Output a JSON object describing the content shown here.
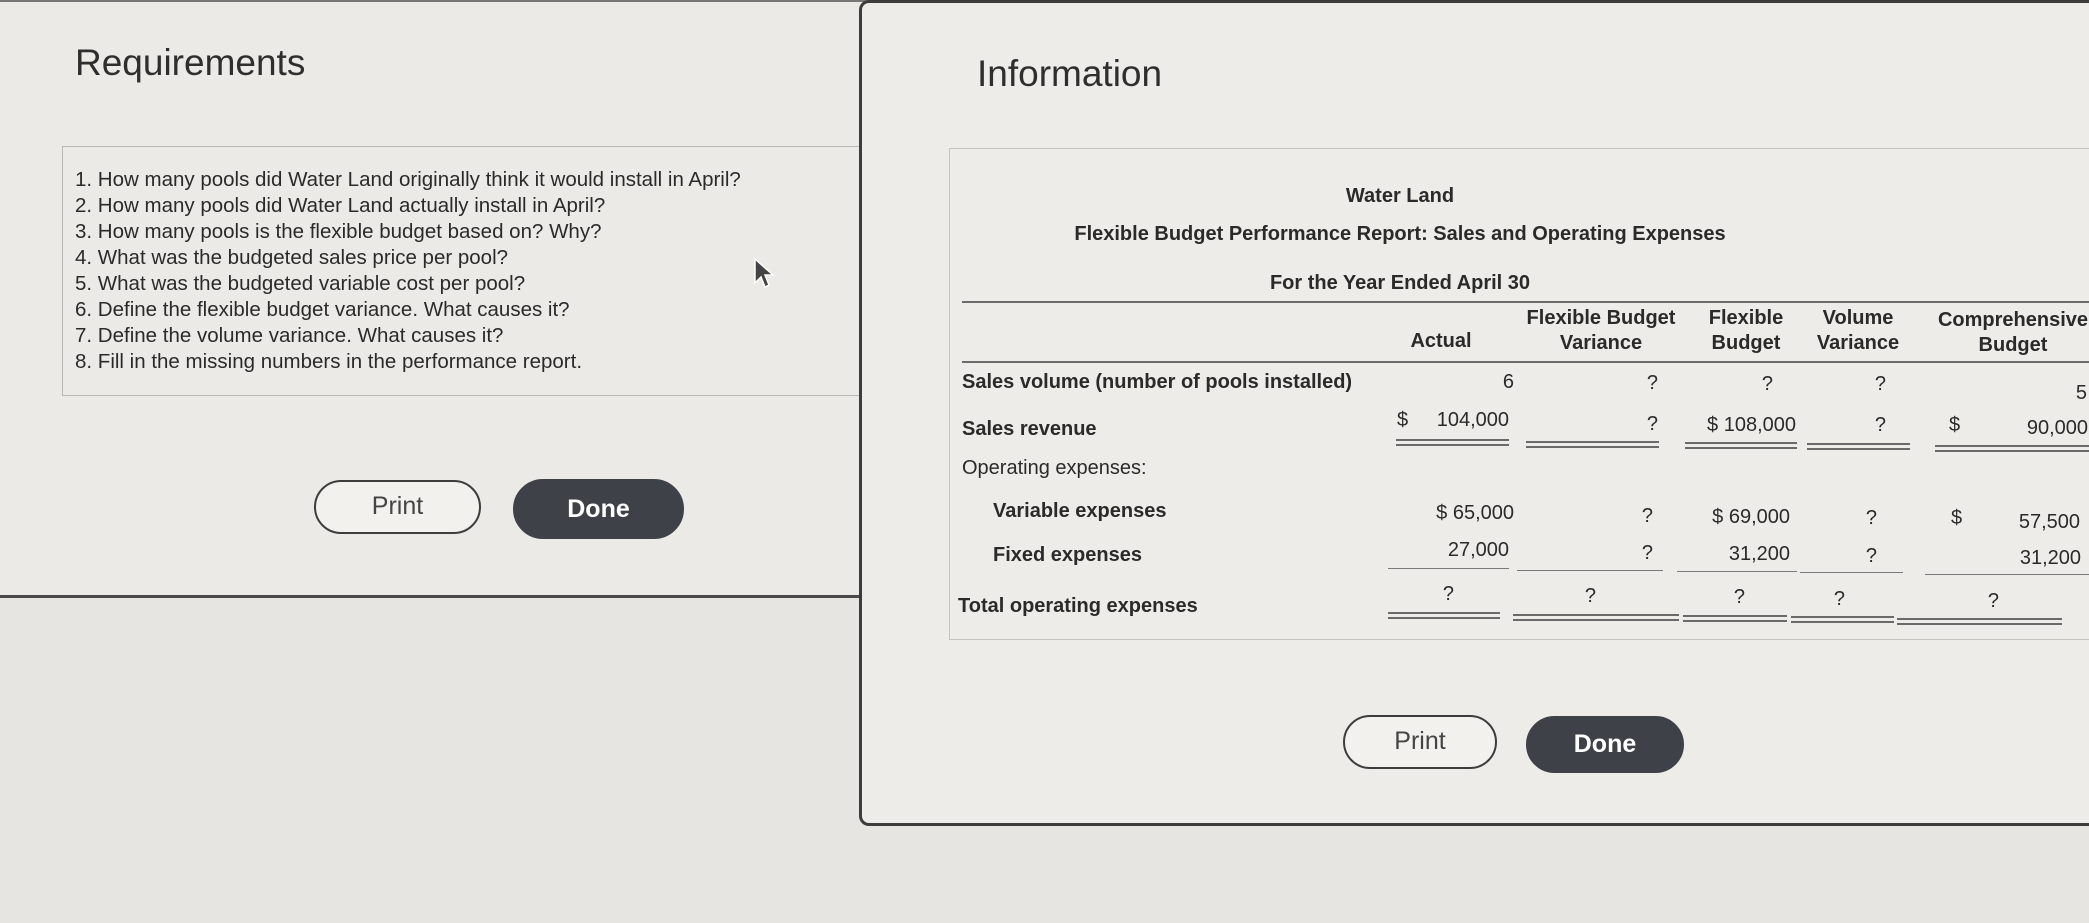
{
  "requirements": {
    "title": "Requirements",
    "items": [
      "1. How many pools did Water Land originally think it would install in April?",
      "2. How many pools did Water Land actually install in April?",
      "3. How many pools is the flexible budget based on? Why?",
      "4. What was the budgeted sales price per pool?",
      "5. What was the budgeted variable cost per pool?",
      "6. Define the flexible budget variance. What causes it?",
      "7. Define the volume variance. What causes it?",
      "8. Fill in the missing numbers in the performance report."
    ],
    "print_label": "Print",
    "done_label": "Done"
  },
  "information": {
    "title": "Information",
    "print_label": "Print",
    "done_label": "Done",
    "report": {
      "company": "Water Land",
      "report_title": "Flexible Budget Performance Report: Sales and Operating Expenses",
      "period": "For the Year Ended April 30",
      "columns": {
        "actual": "Actual",
        "fbv_line1": "Flexible Budget",
        "fbv_line2": "Variance",
        "fb_line1": "Flexible",
        "fb_line2": "Budget",
        "vv_line1": "Volume",
        "vv_line2": "Variance",
        "cb_line1": "Comprehensive",
        "cb_line2": "Budget"
      },
      "rows": {
        "sales_volume": {
          "label": "Sales volume (number of pools installed)",
          "actual": "6",
          "fbv": "?",
          "fb": "?",
          "vv": "?",
          "cb": "5"
        },
        "sales_revenue": {
          "label": "Sales revenue",
          "actual_cur": "$",
          "actual": "104,000",
          "fbv": "?",
          "fb": "$ 108,000",
          "vv": "?",
          "cb_cur": "$",
          "cb": "90,000"
        },
        "operating_expenses": {
          "label": "Operating expenses:"
        },
        "variable_expenses": {
          "label": "Variable expenses",
          "actual": "$ 65,000",
          "fbv": "?",
          "fb": "$ 69,000",
          "vv": "?",
          "cb_cur": "$",
          "cb": "57,500"
        },
        "fixed_expenses": {
          "label": "Fixed expenses",
          "actual": "27,000",
          "fbv": "?",
          "fb": "31,200",
          "vv": "?",
          "cb": "31,200"
        },
        "total_operating": {
          "label": "Total operating expenses",
          "actual": "?",
          "fbv": "?",
          "fb": "?",
          "vv": "?",
          "cb": "?"
        }
      }
    }
  }
}
